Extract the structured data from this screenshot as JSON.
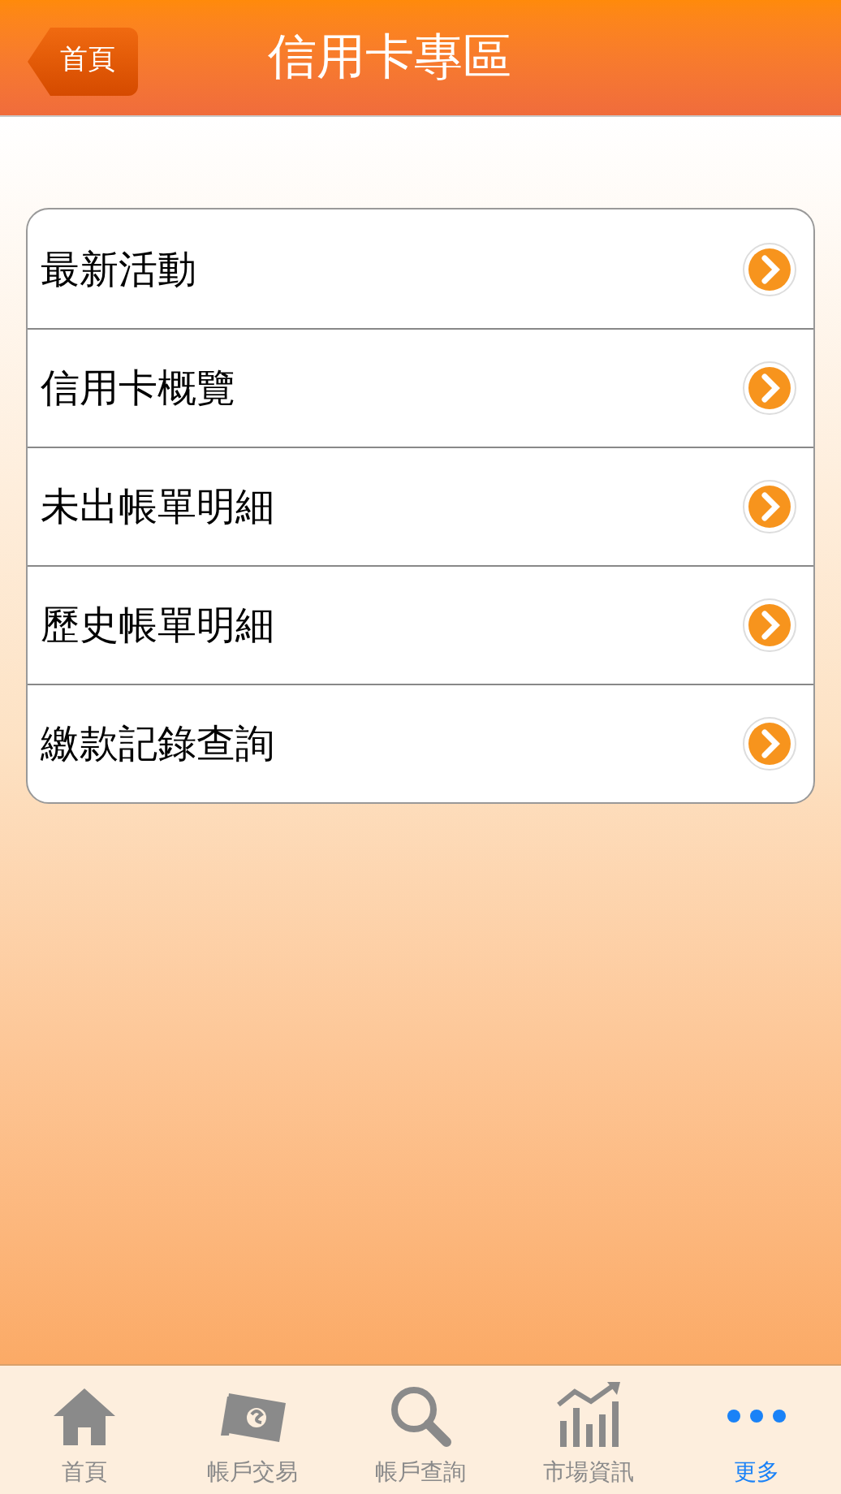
{
  "header": {
    "back_button": "首頁",
    "title": "信用卡專區"
  },
  "menu": [
    {
      "label": "最新活動"
    },
    {
      "label": "信用卡概覽"
    },
    {
      "label": "未出帳單明細"
    },
    {
      "label": "歷史帳單明細"
    },
    {
      "label": "繳款記錄查詢"
    }
  ],
  "tab_bar": [
    {
      "label": "首頁",
      "kind": "home",
      "selected": false
    },
    {
      "label": "帳戶交易",
      "kind": "money",
      "selected": false
    },
    {
      "label": "帳戶查詢",
      "kind": "search",
      "selected": false
    },
    {
      "label": "市場資訊",
      "kind": "chart",
      "selected": false
    },
    {
      "label": "更多",
      "kind": "more",
      "selected": true
    }
  ]
}
